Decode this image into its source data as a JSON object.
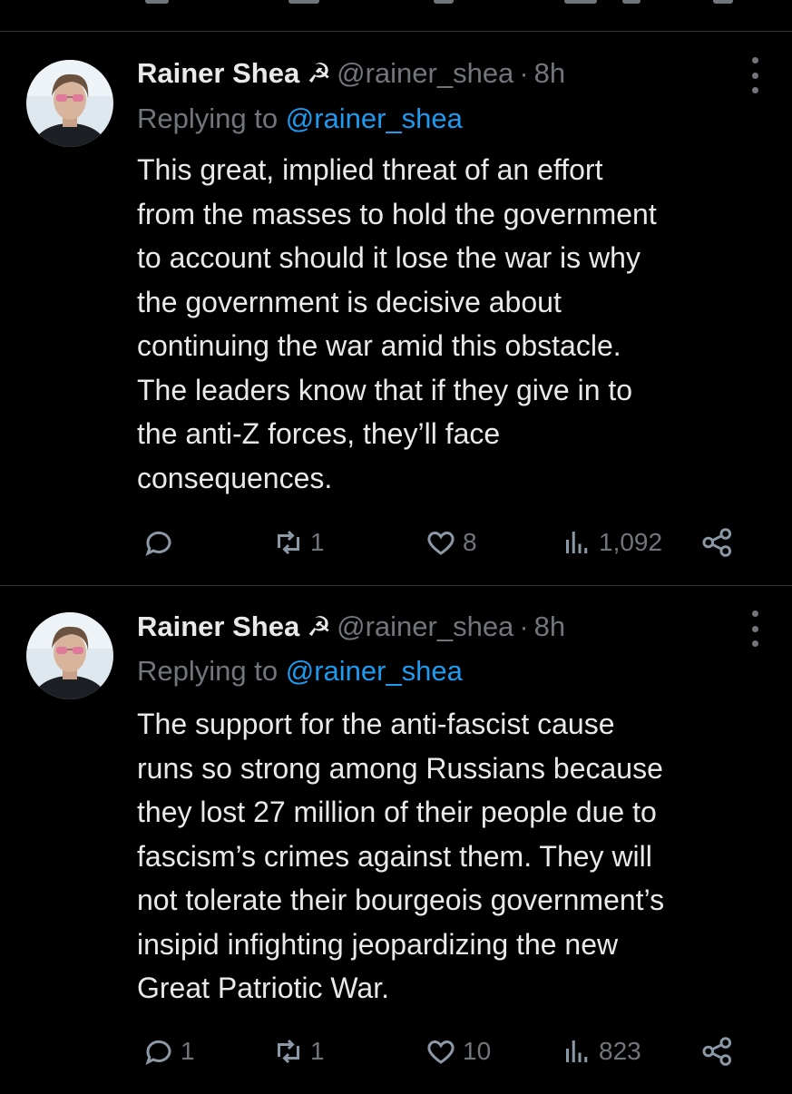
{
  "tweets": [
    {
      "author": {
        "name": "Rainer Shea",
        "badge": "☭",
        "handle": "@rainer_shea",
        "separator": "·",
        "time": "8h"
      },
      "reply": {
        "prefix": "Replying to ",
        "mention": "@rainer_shea"
      },
      "text": "This great, implied threat of an effort\nfrom the masses to hold the government\nto account should it lose the war is why\nthe government is decisive about\ncontinuing the war amid this obstacle.\nThe leaders know that if they give in to\nthe anti-Z forces, they’ll face\nconsequences.",
      "stats": {
        "replies": "",
        "retweets": "1",
        "likes": "8",
        "views": "1,092"
      },
      "icons": [
        "reply-icon",
        "retweet-icon",
        "like-icon",
        "views-icon",
        "share-icon",
        "more-icon"
      ]
    },
    {
      "author": {
        "name": "Rainer Shea",
        "badge": "☭",
        "handle": "@rainer_shea",
        "separator": "·",
        "time": "8h"
      },
      "reply": {
        "prefix": "Replying to ",
        "mention": "@rainer_shea"
      },
      "text": "The support for the anti-fascist cause\nruns so strong among Russians because\nthey lost 27 million of their people due to\nfascism’s crimes against them. They will\nnot tolerate their bourgeois government’s\ninsipid infighting jeopardizing the new\nGreat Patriotic War.",
      "stats": {
        "replies": "1",
        "retweets": "1",
        "likes": "10",
        "views": "823"
      },
      "icons": [
        "reply-icon",
        "retweet-icon",
        "like-icon",
        "views-icon",
        "share-icon",
        "more-icon"
      ]
    }
  ],
  "colors": {
    "background": "#000000",
    "text": "#e7e9ea",
    "muted": "#71767b",
    "link": "#1d9bf0",
    "divider": "#2f3336"
  }
}
